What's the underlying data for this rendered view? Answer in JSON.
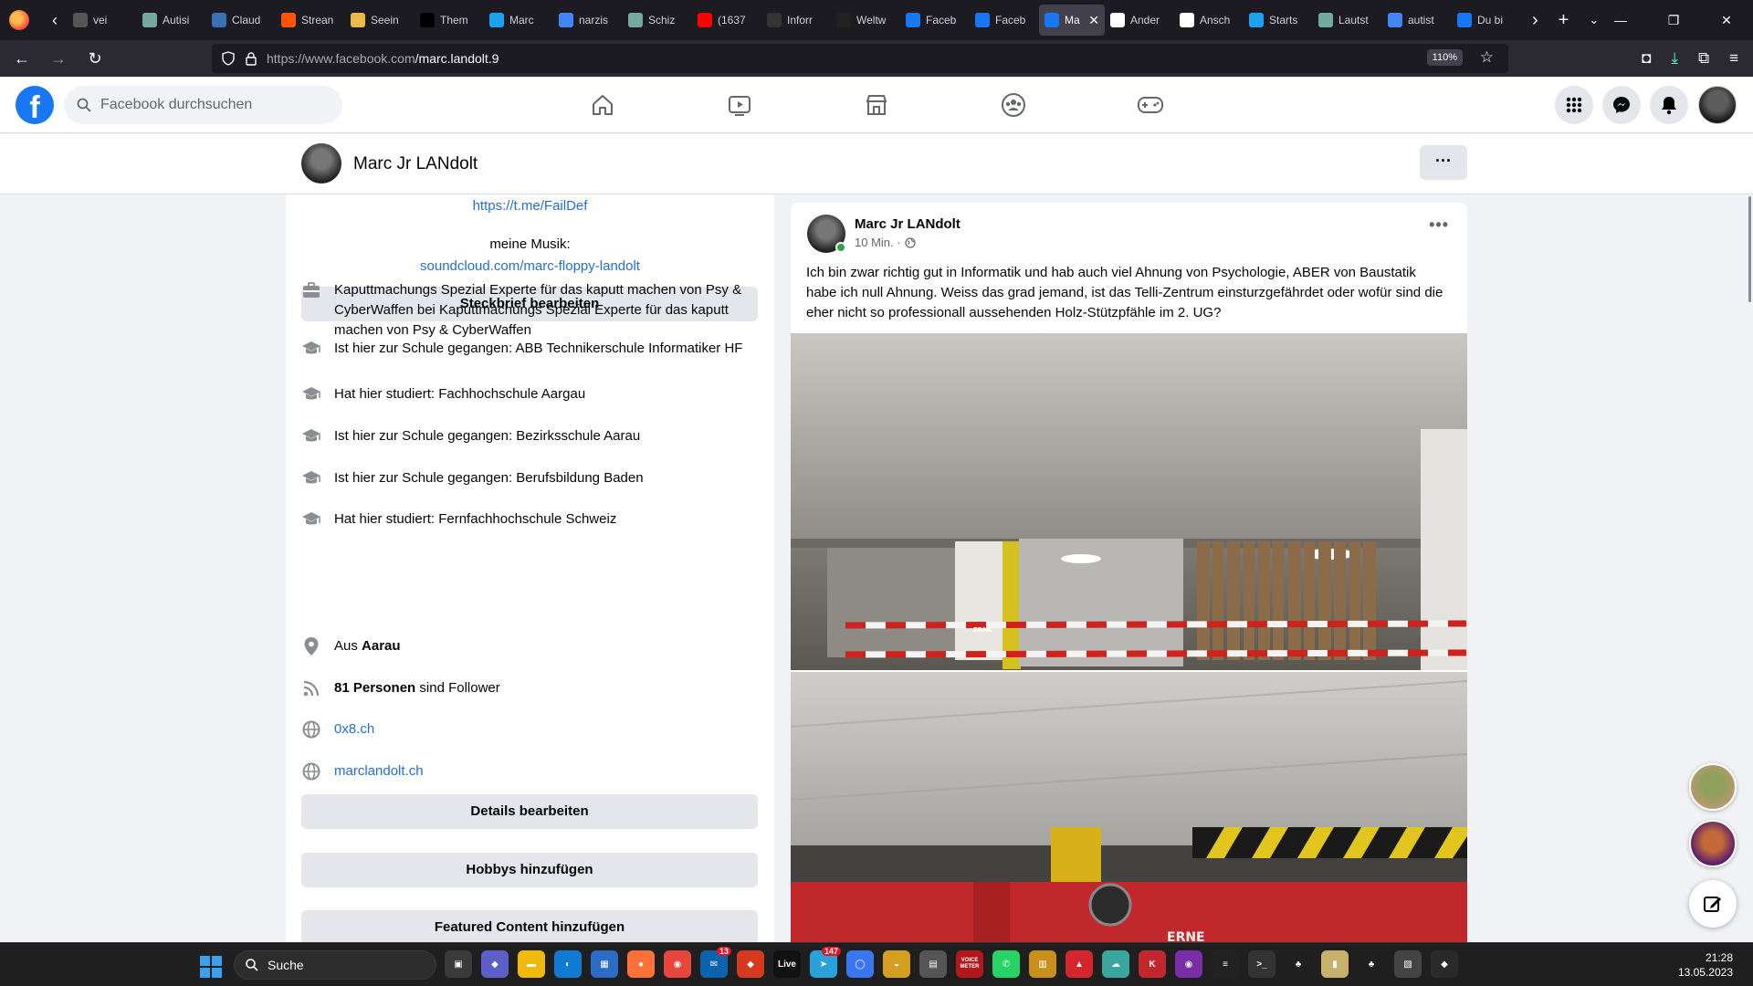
{
  "browser": {
    "tabs": [
      {
        "title": "vei",
        "color": "#555"
      },
      {
        "title": "Autisi",
        "color": "#74aa9c"
      },
      {
        "title": "Claud",
        "color": "#3b6fb6"
      },
      {
        "title": "Strean",
        "color": "#ff5500"
      },
      {
        "title": "Seein",
        "color": "#e9b949"
      },
      {
        "title": "Them",
        "color": "#000000"
      },
      {
        "title": "Marc",
        "color": "#1da1f2"
      },
      {
        "title": "narzis",
        "color": "#4285f4"
      },
      {
        "title": "Schiz",
        "color": "#74aa9c"
      },
      {
        "title": "(1637",
        "color": "#ff0000"
      },
      {
        "title": "Inforr",
        "color": "#333333"
      },
      {
        "title": "Weltw",
        "color": "#222222"
      },
      {
        "title": "Faceb",
        "color": "#1877f2"
      },
      {
        "title": "Faceb",
        "color": "#1877f2"
      },
      {
        "title": "Ma",
        "color": "#1877f2",
        "active": true
      },
      {
        "title": "Ander",
        "color": "#ffffff"
      },
      {
        "title": "Ansch",
        "color": "#ffffff"
      },
      {
        "title": "Starts",
        "color": "#1da1f2"
      },
      {
        "title": "Lautst",
        "color": "#74aa9c"
      },
      {
        "title": "autist",
        "color": "#4285f4"
      },
      {
        "title": "Du bi",
        "color": "#1877f2"
      }
    ],
    "url_host": "https://www.facebook.com",
    "url_path": "/marc.landolt.9",
    "zoom": "110%"
  },
  "facebook": {
    "search_placeholder": "Facebook durchsuchen",
    "logo_letter": "f"
  },
  "profile": {
    "name": "Marc Jr LANdolt",
    "more_label": "···"
  },
  "intro": {
    "link_top": "https://t.me/FailDef",
    "music_label": "meine Musik:",
    "music_link": "soundcloud.com/marc-floppy-landolt",
    "edit_bio_button": "Steckbrief bearbeiten",
    "rows": [
      {
        "icon": "briefcase-icon",
        "text": "Kaputtmachungs Spezial Experte für das kaputt machen von Psy & CyberWaffen bei Kaputtmachungs Spezial Experte für das kaputt machen von Psy & CyberWaffen"
      },
      {
        "icon": "graduation-cap-icon",
        "text": "Ist hier zur Schule gegangen: ABB Technikerschule Informatiker HF"
      },
      {
        "icon": "graduation-cap-icon",
        "text": "Hat hier studiert: Fachhochschule Aargau"
      },
      {
        "icon": "graduation-cap-icon",
        "text": "Ist hier zur Schule gegangen: Bezirksschule Aarau"
      },
      {
        "icon": "graduation-cap-icon",
        "text": "Ist hier zur Schule gegangen: Berufsbildung Baden"
      },
      {
        "icon": "graduation-cap-icon",
        "text": "Hat hier studiert: Fernfachhochschule Schweiz"
      }
    ],
    "location_prefix": "Aus",
    "location_city": "Aarau",
    "followers_count": "81 Personen",
    "followers_suffix": "sind Follower",
    "website1": "0x8.ch",
    "website2": "marclandolt.ch",
    "edit_details_button": "Details bearbeiten",
    "add_hobbies_button": "Hobbys hinzufügen",
    "featured_button": "Featured Content hinzufügen"
  },
  "post": {
    "author": "Marc Jr LANdolt",
    "time": "10 Min. ·",
    "text": "Ich bin zwar richtig gut in Informatik und hab auch viel Ahnung von Psychologie, ABER von Baustatik habe ich null Ahnung. Weiss das grad jemand, ist das Telli-Zentrum einsturzgefährdet oder wofür sind die eher nicht so professionall aussehenden Holz-Stützpfähle im 2. UG?",
    "photo_barrier_text": "ERNE"
  },
  "taskbar": {
    "search_label": "Suche",
    "time": "21:28",
    "date": "13.05.2023",
    "badges": {
      "mail": "13",
      "telegram": "147"
    },
    "labels": {
      "live": "Live",
      "voice": "VOICE METER"
    }
  }
}
